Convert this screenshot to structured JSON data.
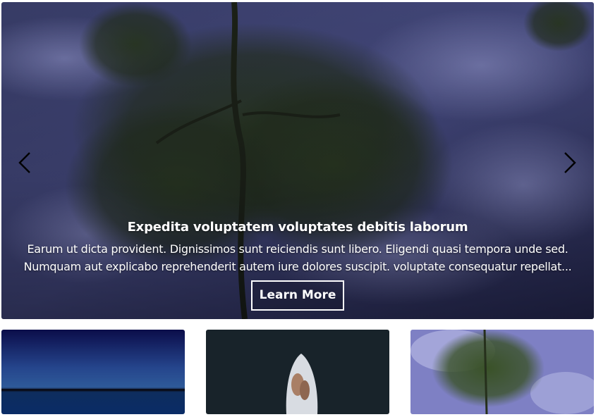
{
  "slider": {
    "title": "Expedita voluptatem voluptates debitis laborum",
    "description": "Earum ut dicta provident. Dignissimos sunt reiciendis sunt libero. Eligendi quasi tempora unde sed. Numquam aut explicabo reprehenderit autem iure dolores suscipit. voluptate consequatur repellat...",
    "button_label": "Learn More",
    "prev_icon": "chevron-left-icon",
    "next_icon": "chevron-right-icon"
  },
  "thumbnails": [
    {
      "icon": "lake-horizon-image"
    },
    {
      "icon": "aerial-rowboat-image"
    },
    {
      "icon": "tree-reflection-image"
    }
  ],
  "colors": {
    "sky": "#4a4f86",
    "foliage": "#2a3a22",
    "caption_text": "#ffffff"
  }
}
